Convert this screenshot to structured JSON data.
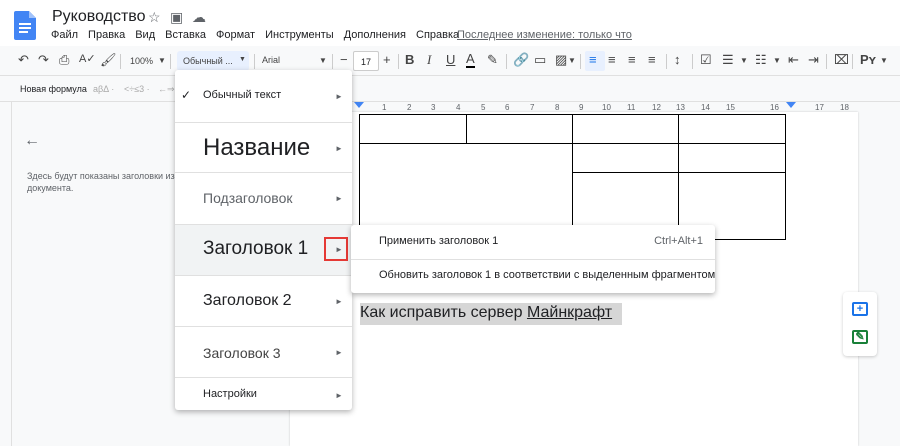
{
  "app": {
    "title": "Руководство",
    "menu": [
      "Файл",
      "Правка",
      "Вид",
      "Вставка",
      "Формат",
      "Инструменты",
      "Дополнения",
      "Справка"
    ],
    "last_edit": "Последнее изменение: только что"
  },
  "toolbar": {
    "zoom": "100%",
    "style": "Обычный ...",
    "font": "Arial",
    "size": "17",
    "minus": "−",
    "plus": "+",
    "bold": "B",
    "italic": "I",
    "underline": "U",
    "text_color": "A",
    "input_tools": "Pʏ"
  },
  "outline_bar": {
    "new_formula": "Новая формула",
    "dim1": "аβΔ ·",
    "dim2": "<÷≤3 ·",
    "dim3": "←⇒↑ ·"
  },
  "sidepanel": {
    "back": "←",
    "message": "Здесь будут показаны заголовки из документа."
  },
  "ruler": {
    "numbers": [
      "1",
      "2",
      "3",
      "4",
      "5",
      "6",
      "7",
      "8",
      "9",
      "10",
      "11",
      "12",
      "13",
      "14",
      "15",
      "16",
      "17",
      "18"
    ]
  },
  "document": {
    "heading_plain": "Как исправить сервер ",
    "heading_link": "Майнкрафт"
  },
  "style_menu": {
    "items": [
      {
        "label": "Обычный текст",
        "checked": true
      },
      {
        "label": "Название"
      },
      {
        "label": "Подзаголовок"
      },
      {
        "label": "Заголовок 1",
        "highlighted": true
      },
      {
        "label": "Заголовок 2"
      },
      {
        "label": "Заголовок 3"
      },
      {
        "label": "Настройки"
      }
    ],
    "arrow": "►",
    "check": "✓"
  },
  "submenu": {
    "apply": "Применить заголовок 1",
    "apply_shortcut": "Ctrl+Alt+1",
    "update": "Обновить заголовок 1 в соответствии с выделенным фрагментом"
  },
  "colors": {
    "accent": "#1a73e8",
    "highlight_box": "#e53935",
    "selected_bg": "#d6d6d6"
  }
}
